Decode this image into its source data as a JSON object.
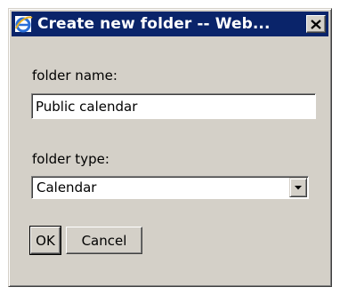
{
  "window": {
    "title": "Create new folder -- Web...",
    "icon": "internet-explorer-icon",
    "close_glyph": "✕"
  },
  "form": {
    "folder_name_label": "folder name:",
    "folder_name_value": "Public calendar",
    "folder_type_label": "folder type:",
    "folder_type_selected": "Calendar"
  },
  "buttons": {
    "ok_label": "OK",
    "cancel_label": "Cancel"
  },
  "colors": {
    "titlebar": "#0a246a",
    "face": "#d4d0c8"
  }
}
